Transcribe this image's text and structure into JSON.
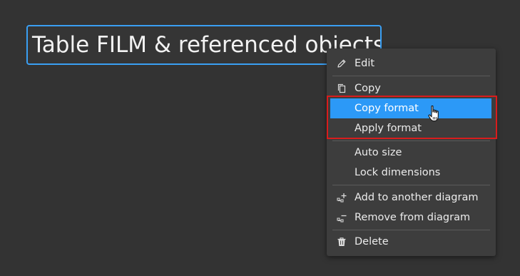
{
  "diagram_node": {
    "title": "Table FILM & referenced objects"
  },
  "context_menu": {
    "edit": {
      "label": "Edit",
      "icon": "pencil-icon"
    },
    "copy": {
      "label": "Copy",
      "icon": "copy-icon"
    },
    "copy_format": {
      "label": "Copy format"
    },
    "apply_format": {
      "label": "Apply format"
    },
    "auto_size": {
      "label": "Auto size"
    },
    "lock_dimensions": {
      "label": "Lock dimensions"
    },
    "add_to_diagram": {
      "label": "Add to another diagram",
      "icon": "add-node-icon"
    },
    "remove_from_diagram": {
      "label": "Remove from diagram",
      "icon": "remove-node-icon"
    },
    "delete": {
      "label": "Delete",
      "icon": "trash-icon"
    }
  },
  "colors": {
    "background": "#333333",
    "menu_background": "#3d3d3d",
    "highlight": "#2c99f7",
    "selection_border": "#3a9ff3",
    "annotation_frame": "#d91c1c"
  }
}
